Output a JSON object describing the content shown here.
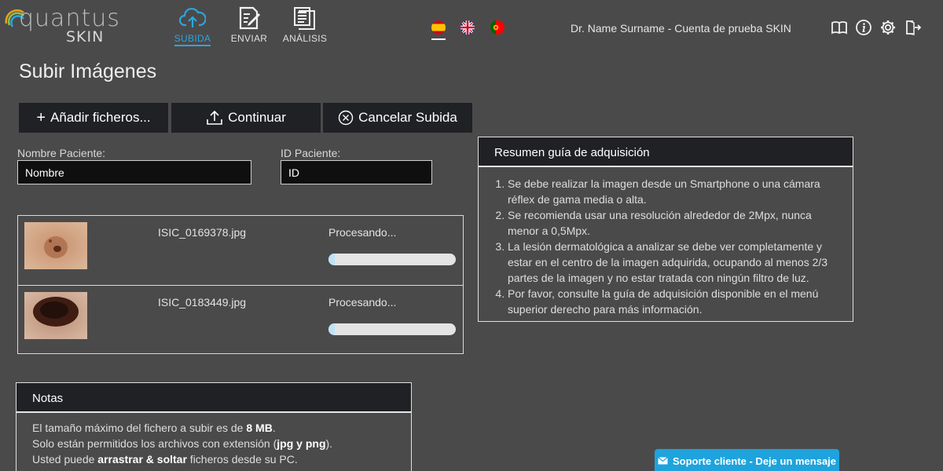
{
  "logo": {
    "line1": "quantus",
    "line2": "SKIN"
  },
  "nav": [
    {
      "label": "SUBIDA",
      "icon": "cloud-upload-icon",
      "active": true
    },
    {
      "label": "ENVIAR",
      "icon": "edit-document-icon",
      "active": false
    },
    {
      "label": "ANÁLISIS",
      "icon": "document-list-icon",
      "active": false
    }
  ],
  "languages": [
    "es",
    "en",
    "pt"
  ],
  "selected_language": "es",
  "user": {
    "name": "Dr. Name Surname - Cuenta de prueba SKIN"
  },
  "page_title": "Subir Imágenes",
  "toolbar": {
    "add_label": "Añadir ficheros...",
    "continue_label": "Continuar",
    "cancel_label": "Cancelar Subida"
  },
  "form": {
    "patient_name_label": "Nombre Paciente:",
    "patient_name_value": "Nombre",
    "patient_id_label": "ID Paciente:",
    "patient_id_value": "ID"
  },
  "uploads": [
    {
      "filename": "ISIC_0169378.jpg",
      "status": "Procesando...",
      "progress": 0.05
    },
    {
      "filename": "ISIC_0183449.jpg",
      "status": "Procesando...",
      "progress": 0.05
    }
  ],
  "guide": {
    "title": "Resumen guía de adquisición",
    "items": [
      "Se debe realizar la imagen desde un Smartphone o una cámara réflex de gama media o alta.",
      "Se recomienda usar una resolución alrededor de 2Mpx, nunca menor a 0,5Mpx.",
      "La lesión dermatológica a analizar se debe ver completamente y estar en el centro de la imagen adquirida, ocupando al menos 2/3 partes de la imagen y no estar tratada con ningún filtro de luz.",
      "Por favor, consulte la guía de adquisición disponible en el menú superior derecho para más información."
    ]
  },
  "notes": {
    "title": "Notas",
    "line1_pre": "El tamaño máximo del fichero a subir es de ",
    "line1_bold": "8 MB",
    "line1_post": ".",
    "line2_pre": "Solo están permitidos los archivos con extensión (",
    "line2_bold": "jpg y png",
    "line2_post": ").",
    "line3_pre": "Usted puede ",
    "line3_bold": "arrastrar & soltar",
    "line3_post": " ficheros desde su PC."
  },
  "support": {
    "label": "Soporte cliente - Deje un mensaje",
    "icon": "mail-icon"
  },
  "colors": {
    "accent": "#2aa6e0",
    "background": "#4b4a4b",
    "panel": "#1f2124",
    "support": "#1ea3dd"
  }
}
